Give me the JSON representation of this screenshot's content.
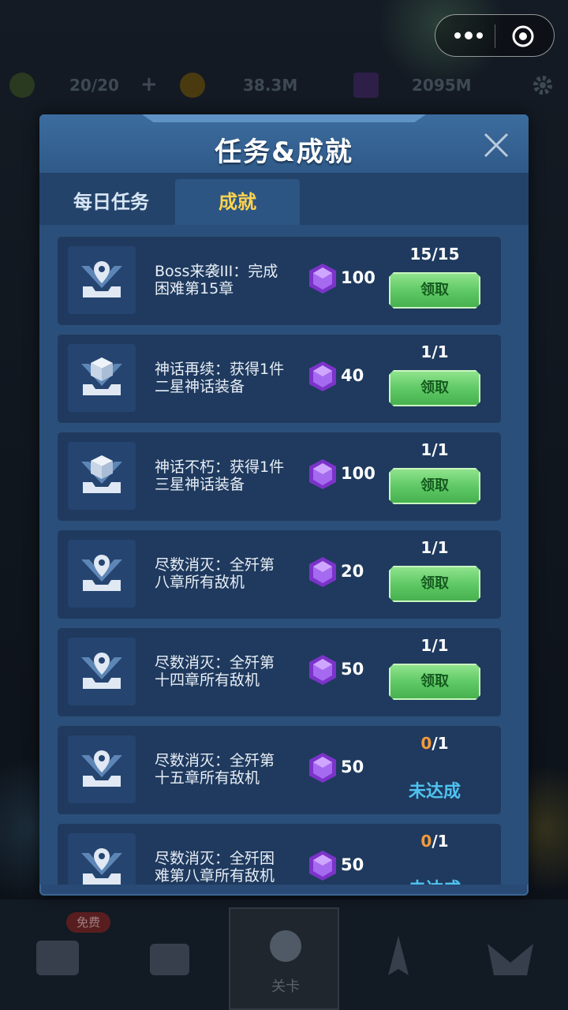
{
  "topbar": {
    "energy": "20/20",
    "plus": "+",
    "coins": "38.3M",
    "gems": "2095M"
  },
  "modal": {
    "title": "任务&成就",
    "tabs": [
      {
        "label": "每日任务",
        "active": false
      },
      {
        "label": "成就",
        "active": true
      }
    ],
    "tasks": [
      {
        "icon": "location-pin-icon",
        "desc": "Boss来袭III：完成\n困难第15章",
        "reward": "100",
        "progress_cur": "15",
        "progress_total": "/15",
        "claim_label": "领取",
        "status": null
      },
      {
        "icon": "box-icon",
        "desc": "神话再续：获得1件\n二星神话装备",
        "reward": "40",
        "progress_cur": "1",
        "progress_total": "/1",
        "claim_label": "领取",
        "status": null
      },
      {
        "icon": "box-icon",
        "desc": "神话不朽：获得1件\n三星神话装备",
        "reward": "100",
        "progress_cur": "1",
        "progress_total": "/1",
        "claim_label": "领取",
        "status": null
      },
      {
        "icon": "location-pin-icon",
        "desc": "尽数消灭：全歼第\n八章所有敌机",
        "reward": "20",
        "progress_cur": "1",
        "progress_total": "/1",
        "claim_label": "领取",
        "status": null
      },
      {
        "icon": "location-pin-icon",
        "desc": "尽数消灭：全歼第\n十四章所有敌机",
        "reward": "50",
        "progress_cur": "1",
        "progress_total": "/1",
        "claim_label": "领取",
        "status": null
      },
      {
        "icon": "location-pin-icon",
        "desc": "尽数消灭：全歼第\n十五章所有敌机",
        "reward": "50",
        "progress_cur": "0",
        "progress_total": "/1",
        "claim_label": null,
        "status": "未达成"
      },
      {
        "icon": "location-pin-icon",
        "desc": "尽数消灭：全歼困\n难第八章所有敌机",
        "reward": "50",
        "progress_cur": "0",
        "progress_total": "/1",
        "claim_label": null,
        "status": "未达成"
      }
    ]
  },
  "bottom_nav": {
    "free_tag": "免费",
    "center_label": "关卡"
  },
  "colors": {
    "modal_bg": "#284a74",
    "card_bg": "#1f3a5e",
    "active_tab_text": "#ffd34e",
    "claim_green": "#5cc763",
    "incomplete_blue": "#4fc3f0",
    "zero_orange": "#f39a3a",
    "gem_purple": "#8b3fd6"
  }
}
